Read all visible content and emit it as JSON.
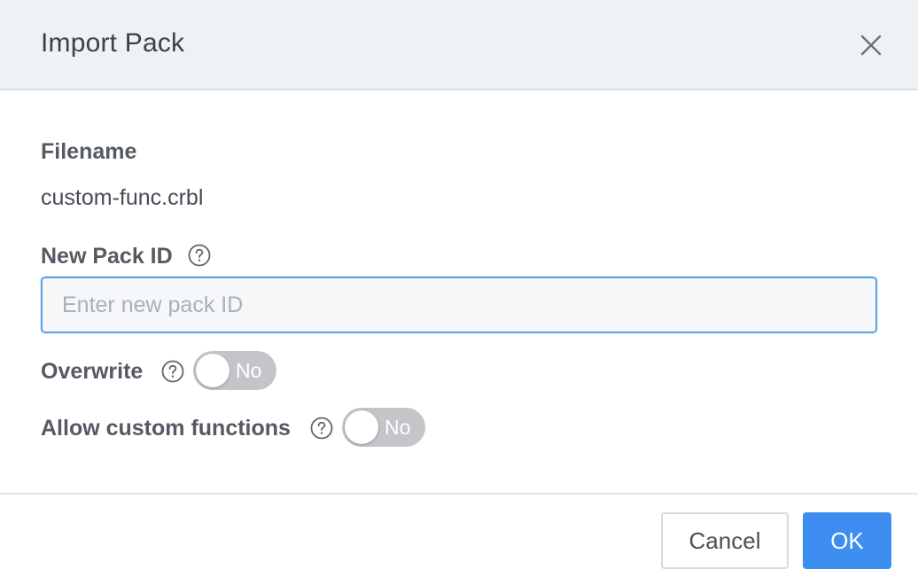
{
  "dialog": {
    "title": "Import Pack",
    "close_icon": "close-icon"
  },
  "filename": {
    "label": "Filename",
    "value": "custom-func.crbl"
  },
  "pack_id": {
    "label": "New Pack ID",
    "help_icon": "help-circle-icon",
    "value": "",
    "placeholder": "Enter new pack ID"
  },
  "overwrite": {
    "label": "Overwrite",
    "help_icon": "help-circle-icon",
    "state_label": "No",
    "enabled": false
  },
  "allow_custom_functions": {
    "label": "Allow custom functions",
    "help_icon": "help-circle-icon",
    "state_label": "No",
    "enabled": false
  },
  "footer": {
    "cancel_label": "Cancel",
    "ok_label": "OK"
  },
  "colors": {
    "header_bg": "#eef2f6",
    "primary": "#3d8ef0",
    "toggle_off": "#c3c5c9",
    "input_focus_border": "#5aa3e8"
  }
}
